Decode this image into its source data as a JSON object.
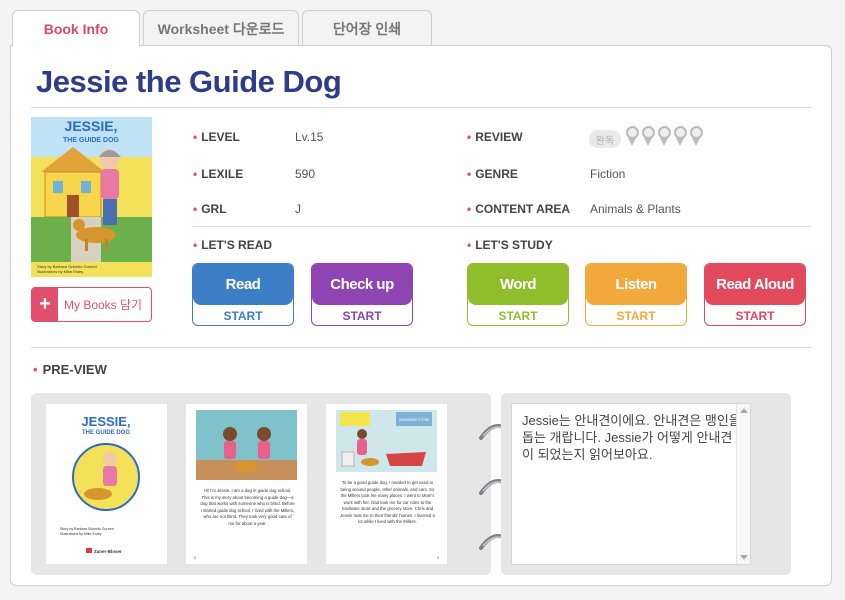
{
  "tabs": [
    {
      "label": "Book Info",
      "active": true
    },
    {
      "label": "Worksheet 다운로드",
      "active": false
    },
    {
      "label": "단어장 인쇄",
      "active": false
    }
  ],
  "book": {
    "title": "Jessie the Guide Dog",
    "cover_title": "JESSIE, THE GUIDE DOG",
    "cover_credits": "Story by Barbara Schmitz Gurrieri  Illustrations by Mike Estey"
  },
  "my_books": {
    "icon": "plus-icon",
    "label": "My Books 담기"
  },
  "info": {
    "level": {
      "label": "LEVEL",
      "value": "Lv.15"
    },
    "lexile": {
      "label": "LEXILE",
      "value": "590"
    },
    "grl": {
      "label": "GRL",
      "value": "J"
    },
    "review": {
      "label": "REVIEW",
      "badge": "완독",
      "medals": 5
    },
    "genre": {
      "label": "GENRE",
      "value": "Fiction"
    },
    "content_area": {
      "label": "CONTENT AREA",
      "value": "Animals & Plants"
    }
  },
  "lets_read": {
    "label": "LET'S READ",
    "buttons": [
      {
        "label": "Read",
        "sub": "START",
        "color": "#3c7fc7"
      },
      {
        "label": "Check up",
        "sub": "START",
        "color": "#8e44b3"
      }
    ]
  },
  "lets_study": {
    "label": "LET'S STUDY",
    "buttons": [
      {
        "label": "Word",
        "sub": "START",
        "color": "#8fbd2c"
      },
      {
        "label": "Listen",
        "sub": "START",
        "color": "#f2a93b"
      },
      {
        "label": "Read Aloud",
        "sub": "START",
        "color": "#e2495d"
      }
    ]
  },
  "preview": {
    "label": "PRE-VIEW",
    "pages": [
      {
        "title": "JESSIE, THE GUIDE DOG",
        "credits": "Story by Barbara Schmitz Gurrieri  Illustrations by Mike Estey",
        "publisher": "Zaner-Bloser"
      },
      {
        "text": "Hi! I'm Jessie. I am a dog in guide dog school. This is my story about becoming a guide dog—a dog that works with someone who is blind. Before I started guide dog school, I lived with the Millers, who are not blind. They took very good care of me for about a year.",
        "num": "2"
      },
      {
        "text": "To be a good guide dog, I needed to get used to being around people, other animals, and cars. So the Millers took me many places. I went to Mom's work with her. Dad took me for car rides to the hardware store and the grocery store. Chris and Jessie took me to their friends' homes. I learned a lot while I lived with the Millers.",
        "num": "3",
        "sign1": "HARDWARE STORE"
      }
    ],
    "description": "Jessie는 안내견이에요. 안내견은 맹인을 돕는 개랍니다. Jessie가 어떻게 안내견이 되었는지 읽어보아요."
  }
}
